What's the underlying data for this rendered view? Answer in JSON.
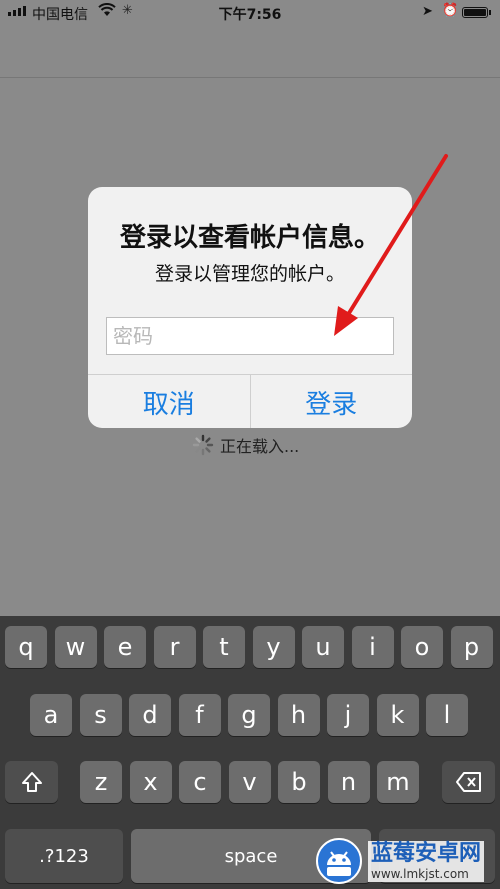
{
  "status_bar": {
    "carrier": "中国电信",
    "time": "下午7:56",
    "icons": [
      "signal-icon",
      "wifi-icon",
      "activity-icon",
      "location-icon",
      "alarm-icon",
      "battery-icon"
    ]
  },
  "dialog": {
    "title": "登录以查看帐户信息。",
    "message": "登录以管理您的帐户。",
    "password_placeholder": "密码",
    "password_value": "",
    "cancel_label": "取消",
    "login_label": "登录"
  },
  "loading": {
    "text": "正在载入..."
  },
  "keyboard": {
    "row1": [
      "q",
      "w",
      "e",
      "r",
      "t",
      "y",
      "u",
      "i",
      "o",
      "p"
    ],
    "row2": [
      "a",
      "s",
      "d",
      "f",
      "g",
      "h",
      "j",
      "k",
      "l"
    ],
    "row3": [
      "z",
      "x",
      "c",
      "v",
      "b",
      "n",
      "m"
    ],
    "numbers_label": ".?123",
    "space_label": "space"
  },
  "watermark": {
    "name": "蓝莓安卓网",
    "url": "www.lmkjst.com"
  },
  "colors": {
    "accent_blue": "#1a7ee0",
    "annotation_red": "#e01b1b",
    "overlay": "#8a8a8a",
    "keyboard_bg": "#3b3b3b"
  }
}
